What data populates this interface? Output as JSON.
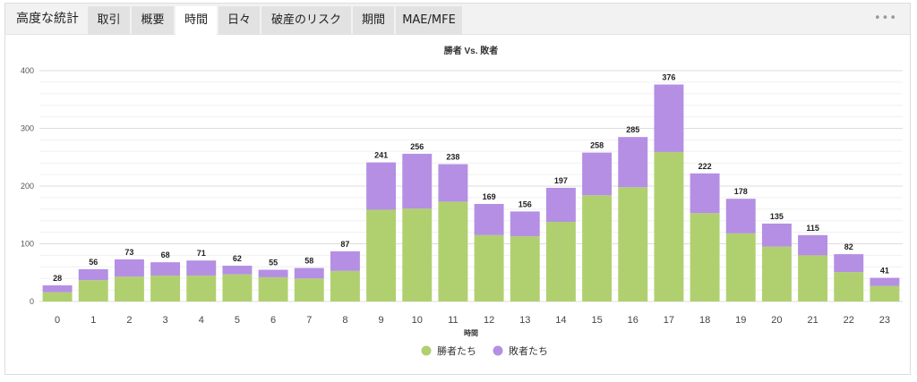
{
  "header": {
    "title": "高度な統計",
    "tabs": [
      {
        "label": "取引"
      },
      {
        "label": "概要"
      },
      {
        "label": "時間"
      },
      {
        "label": "日々"
      },
      {
        "label": "破産のリスク"
      },
      {
        "label": "期間"
      },
      {
        "label": "MAE/MFE"
      }
    ],
    "active_tab": "時間",
    "more_icon": "ellipsis-icon",
    "more_label": "•••"
  },
  "chart_data": {
    "type": "bar",
    "stacked": true,
    "title": "勝者 Vs. 敗者",
    "xlabel": "時間",
    "ylabel": "",
    "ylim": [
      0,
      400
    ],
    "yticks": [
      0,
      100,
      200,
      300,
      400
    ],
    "grid": true,
    "legend_position": "bottom",
    "categories": [
      "0",
      "1",
      "2",
      "3",
      "4",
      "5",
      "6",
      "7",
      "8",
      "9",
      "10",
      "11",
      "12",
      "13",
      "14",
      "15",
      "16",
      "17",
      "18",
      "19",
      "20",
      "21",
      "22",
      "23"
    ],
    "totals": [
      28,
      56,
      73,
      68,
      71,
      62,
      55,
      58,
      87,
      241,
      256,
      238,
      169,
      156,
      197,
      258,
      285,
      376,
      222,
      178,
      135,
      115,
      82,
      41
    ],
    "series": [
      {
        "name": "勝者たち",
        "color": "#b0d070",
        "values": [
          16,
          37,
          43,
          45,
          45,
          47,
          42,
          40,
          53,
          159,
          161,
          173,
          115,
          113,
          138,
          184,
          198,
          259,
          153,
          118,
          95,
          80,
          51,
          27
        ]
      },
      {
        "name": "敗者たち",
        "color": "#b48fe3",
        "values": [
          12,
          19,
          30,
          23,
          26,
          15,
          13,
          18,
          34,
          82,
          95,
          65,
          54,
          43,
          59,
          74,
          87,
          117,
          69,
          60,
          40,
          35,
          31,
          14
        ]
      }
    ]
  }
}
